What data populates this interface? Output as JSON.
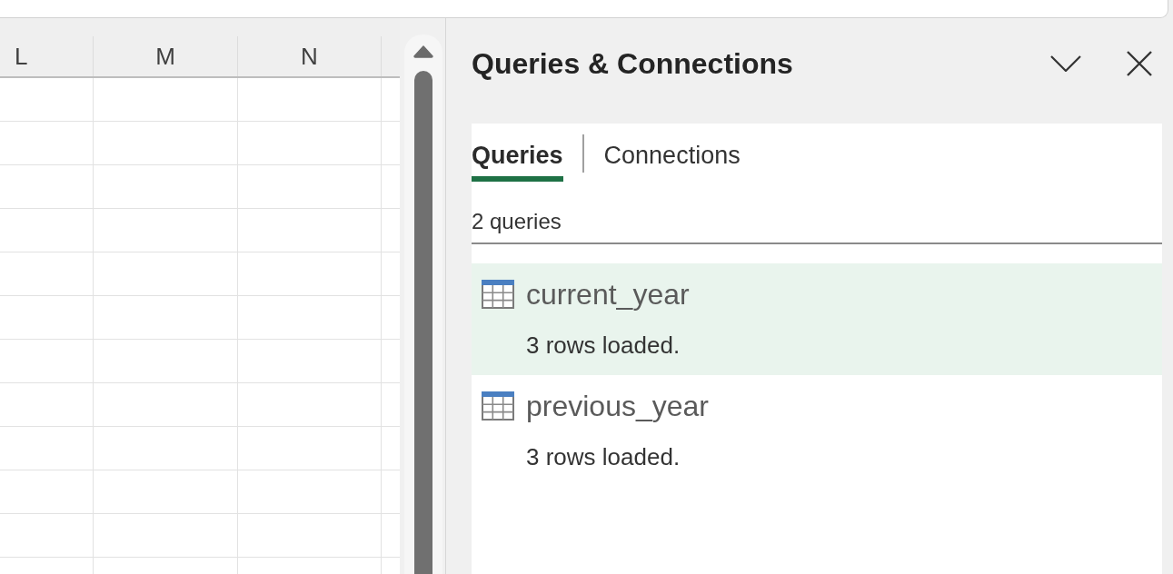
{
  "sheet": {
    "columns": [
      "L",
      "M",
      "N"
    ]
  },
  "pane": {
    "title": "Queries & Connections",
    "tabs": [
      {
        "label": "Queries",
        "selected": true
      },
      {
        "label": "Connections",
        "selected": false
      }
    ],
    "count": "2 queries",
    "queries": [
      {
        "name": "current_year",
        "status": "3 rows loaded.",
        "selected": true
      },
      {
        "name": "previous_year",
        "status": "3 rows loaded.",
        "selected": false
      }
    ]
  }
}
